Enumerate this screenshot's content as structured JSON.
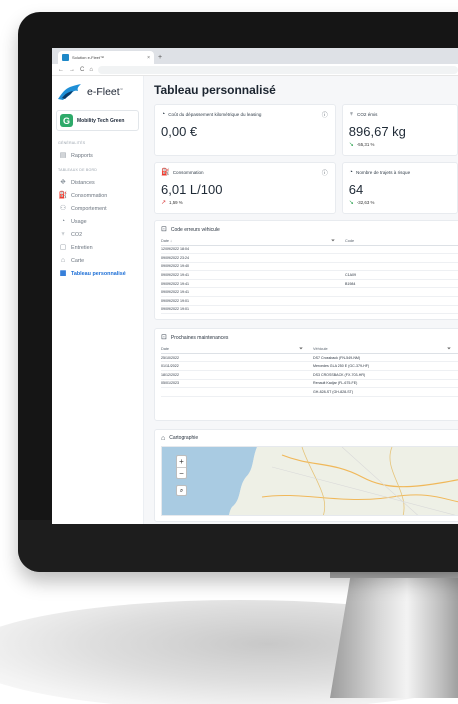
{
  "browser": {
    "tab_title": "Solution e-Fleet™",
    "tab_close": "×",
    "new_tab": "+",
    "nav": {
      "back": "←",
      "forward": "→",
      "reload": "C",
      "home": "⌂"
    }
  },
  "sidebar": {
    "brand": "e-Fleet",
    "brand_mark": "™",
    "org_initial": "G",
    "org_name": "Mobility Tech Green",
    "section_1": "Généralités",
    "section_2": "Tableaux de bord",
    "items": [
      {
        "label": "Rapports",
        "icon": "report-icon"
      },
      {
        "label": "Distances",
        "icon": "road-icon"
      },
      {
        "label": "Consommation",
        "icon": "fuel-icon"
      },
      {
        "label": "Comportement",
        "icon": "behavior-icon"
      },
      {
        "label": "Usage",
        "icon": "gauge-icon"
      },
      {
        "label": "CO2",
        "icon": "co2-icon"
      },
      {
        "label": "Entretien",
        "icon": "maintenance-icon"
      },
      {
        "label": "Carte",
        "icon": "map-icon"
      },
      {
        "label": "Tableau personnalisé",
        "icon": "grid-icon",
        "active": true
      }
    ]
  },
  "main": {
    "title": "Tableau personnalisé",
    "kpis": {
      "cost": {
        "label": "Coût du dépassement kilométrique du leasing",
        "value": "0,00 €"
      },
      "co2": {
        "label": "CO2 émis",
        "value": "896,67 kg",
        "delta": "-55,31 %"
      },
      "consumption": {
        "label": "Consommation",
        "value": "6,01 L/100",
        "delta": "1,59 %"
      },
      "risky_trips": {
        "label": "Nombre de trajets à risque",
        "value": "64",
        "delta": "-32,63 %"
      }
    },
    "error_codes": {
      "title": "Code erreurs véhicule",
      "columns": [
        "Date ↓",
        "Code"
      ],
      "rows": [
        {
          "date": "12/09/2022 18:04",
          "code": ""
        },
        {
          "date": "09/09/2022 23:24",
          "code": ""
        },
        {
          "date": "09/09/2022 19:40",
          "code": ""
        },
        {
          "date": "09/09/2022 19:41",
          "code": "C1A09"
        },
        {
          "date": "09/09/2022 19:41",
          "code": "B1984"
        },
        {
          "date": "09/09/2022 19:41",
          "code": ""
        },
        {
          "date": "09/09/2022 19:01",
          "code": ""
        },
        {
          "date": "09/09/2022 19:01",
          "code": ""
        }
      ]
    },
    "maintenance": {
      "title": "Prochaines maintenances",
      "columns": [
        "Date",
        "Véhicule"
      ],
      "rows": [
        {
          "date": "25/10/2022",
          "vehicle": "DS7 Crossback (FN-549-NM)"
        },
        {
          "date": "01/11/2022",
          "vehicle": "Mercedes GLA 250 E (GC-379-HF)"
        },
        {
          "date": "18/12/2022",
          "vehicle": "DS3 CROSSBACK (FX-703-HR)"
        },
        {
          "date": "05/01/2023",
          "vehicle": "Renault Kadjar (FL-675-FE)"
        },
        {
          "date": "",
          "vehicle": "GH-828-ST (GH-828-ST)"
        }
      ]
    },
    "map": {
      "title": "Cartographie",
      "zoom_in": "+",
      "zoom_out": "−"
    }
  }
}
